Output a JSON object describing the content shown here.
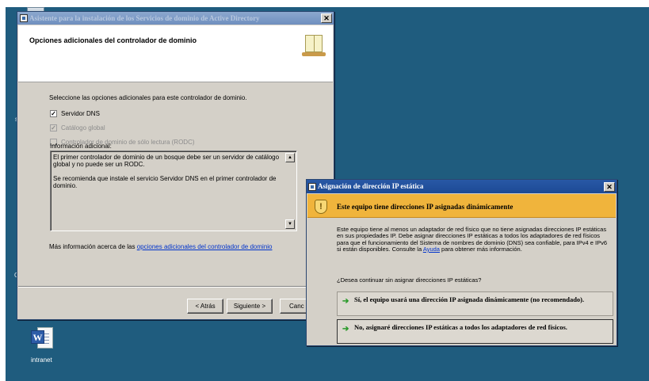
{
  "desktop": {
    "icons": [
      {
        "label": "intranet",
        "icon": "word-document-icon"
      }
    ],
    "edge_letters": [
      "s",
      "G"
    ]
  },
  "wizard": {
    "title": "Asistente para la instalación de los Servicios de dominio de Active Directory",
    "header_title": "Opciones adicionales del controlador de dominio",
    "instruction": "Seleccione las opciones adicionales para este controlador de dominio.",
    "options": [
      {
        "label": "Servidor DNS",
        "checked": true,
        "enabled": true
      },
      {
        "label": "Catálogo global",
        "checked": true,
        "enabled": false
      },
      {
        "label": "Controlador de dominio de sólo lectura (RODC)",
        "checked": false,
        "enabled": false
      }
    ],
    "additional_info_label": "Información adicional:",
    "additional_info_paragraphs": [
      "El primer controlador de dominio de un bosque debe ser un servidor de catálogo global y no puede ser un RODC.",
      "Se recomienda que instale el servicio Servidor DNS en el primer controlador de dominio."
    ],
    "more_info_prefix": "Más información acerca de las ",
    "more_info_link": "opciones adicionales del controlador de dominio",
    "buttons": {
      "back": "< Atrás",
      "next": "Siguiente >",
      "cancel": "Canc"
    }
  },
  "dialog": {
    "title": "Asignación de dirección IP estática",
    "banner": "Este equipo tiene direcciones IP asignadas dinámicamente",
    "body_text": "Este equipo tiene al menos un adaptador de red físico que no tiene asignadas direcciones IP estáticas en sus propiedades IP. Debe asignar direcciones IP estáticas a todos los adaptadores de red físicos para que el funcionamiento del Sistema de nombres de dominio (DNS) sea confiable, para IPv4 e IPv6 si están disponibles. Consulte la ",
    "body_link": "Ayuda",
    "body_suffix": " para obtener más información.",
    "question": "¿Desea continuar sin asignar direcciones IP estáticas?",
    "options": [
      {
        "label": "Sí, el equipo usará una dirección IP asignada dinámicamente (no recomendado)."
      },
      {
        "label": "No, asignaré direcciones IP estáticas a todos los adaptadores de red físicos."
      }
    ]
  }
}
